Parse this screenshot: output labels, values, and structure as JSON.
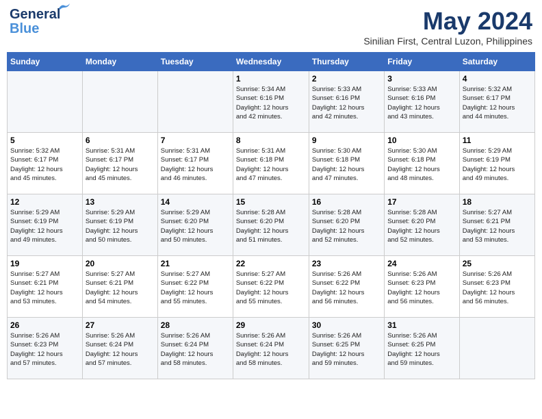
{
  "header": {
    "logo_line1": "General",
    "logo_line2": "Blue",
    "month": "May 2024",
    "location": "Sinilian First, Central Luzon, Philippines"
  },
  "days_of_week": [
    "Sunday",
    "Monday",
    "Tuesday",
    "Wednesday",
    "Thursday",
    "Friday",
    "Saturday"
  ],
  "weeks": [
    {
      "days": [
        {
          "num": "",
          "info": ""
        },
        {
          "num": "",
          "info": ""
        },
        {
          "num": "",
          "info": ""
        },
        {
          "num": "1",
          "info": "Sunrise: 5:34 AM\nSunset: 6:16 PM\nDaylight: 12 hours\nand 42 minutes."
        },
        {
          "num": "2",
          "info": "Sunrise: 5:33 AM\nSunset: 6:16 PM\nDaylight: 12 hours\nand 42 minutes."
        },
        {
          "num": "3",
          "info": "Sunrise: 5:33 AM\nSunset: 6:16 PM\nDaylight: 12 hours\nand 43 minutes."
        },
        {
          "num": "4",
          "info": "Sunrise: 5:32 AM\nSunset: 6:17 PM\nDaylight: 12 hours\nand 44 minutes."
        }
      ]
    },
    {
      "days": [
        {
          "num": "5",
          "info": "Sunrise: 5:32 AM\nSunset: 6:17 PM\nDaylight: 12 hours\nand 45 minutes."
        },
        {
          "num": "6",
          "info": "Sunrise: 5:31 AM\nSunset: 6:17 PM\nDaylight: 12 hours\nand 45 minutes."
        },
        {
          "num": "7",
          "info": "Sunrise: 5:31 AM\nSunset: 6:17 PM\nDaylight: 12 hours\nand 46 minutes."
        },
        {
          "num": "8",
          "info": "Sunrise: 5:31 AM\nSunset: 6:18 PM\nDaylight: 12 hours\nand 47 minutes."
        },
        {
          "num": "9",
          "info": "Sunrise: 5:30 AM\nSunset: 6:18 PM\nDaylight: 12 hours\nand 47 minutes."
        },
        {
          "num": "10",
          "info": "Sunrise: 5:30 AM\nSunset: 6:18 PM\nDaylight: 12 hours\nand 48 minutes."
        },
        {
          "num": "11",
          "info": "Sunrise: 5:29 AM\nSunset: 6:19 PM\nDaylight: 12 hours\nand 49 minutes."
        }
      ]
    },
    {
      "days": [
        {
          "num": "12",
          "info": "Sunrise: 5:29 AM\nSunset: 6:19 PM\nDaylight: 12 hours\nand 49 minutes."
        },
        {
          "num": "13",
          "info": "Sunrise: 5:29 AM\nSunset: 6:19 PM\nDaylight: 12 hours\nand 50 minutes."
        },
        {
          "num": "14",
          "info": "Sunrise: 5:29 AM\nSunset: 6:20 PM\nDaylight: 12 hours\nand 50 minutes."
        },
        {
          "num": "15",
          "info": "Sunrise: 5:28 AM\nSunset: 6:20 PM\nDaylight: 12 hours\nand 51 minutes."
        },
        {
          "num": "16",
          "info": "Sunrise: 5:28 AM\nSunset: 6:20 PM\nDaylight: 12 hours\nand 52 minutes."
        },
        {
          "num": "17",
          "info": "Sunrise: 5:28 AM\nSunset: 6:20 PM\nDaylight: 12 hours\nand 52 minutes."
        },
        {
          "num": "18",
          "info": "Sunrise: 5:27 AM\nSunset: 6:21 PM\nDaylight: 12 hours\nand 53 minutes."
        }
      ]
    },
    {
      "days": [
        {
          "num": "19",
          "info": "Sunrise: 5:27 AM\nSunset: 6:21 PM\nDaylight: 12 hours\nand 53 minutes."
        },
        {
          "num": "20",
          "info": "Sunrise: 5:27 AM\nSunset: 6:21 PM\nDaylight: 12 hours\nand 54 minutes."
        },
        {
          "num": "21",
          "info": "Sunrise: 5:27 AM\nSunset: 6:22 PM\nDaylight: 12 hours\nand 55 minutes."
        },
        {
          "num": "22",
          "info": "Sunrise: 5:27 AM\nSunset: 6:22 PM\nDaylight: 12 hours\nand 55 minutes."
        },
        {
          "num": "23",
          "info": "Sunrise: 5:26 AM\nSunset: 6:22 PM\nDaylight: 12 hours\nand 56 minutes."
        },
        {
          "num": "24",
          "info": "Sunrise: 5:26 AM\nSunset: 6:23 PM\nDaylight: 12 hours\nand 56 minutes."
        },
        {
          "num": "25",
          "info": "Sunrise: 5:26 AM\nSunset: 6:23 PM\nDaylight: 12 hours\nand 56 minutes."
        }
      ]
    },
    {
      "days": [
        {
          "num": "26",
          "info": "Sunrise: 5:26 AM\nSunset: 6:23 PM\nDaylight: 12 hours\nand 57 minutes."
        },
        {
          "num": "27",
          "info": "Sunrise: 5:26 AM\nSunset: 6:24 PM\nDaylight: 12 hours\nand 57 minutes."
        },
        {
          "num": "28",
          "info": "Sunrise: 5:26 AM\nSunset: 6:24 PM\nDaylight: 12 hours\nand 58 minutes."
        },
        {
          "num": "29",
          "info": "Sunrise: 5:26 AM\nSunset: 6:24 PM\nDaylight: 12 hours\nand 58 minutes."
        },
        {
          "num": "30",
          "info": "Sunrise: 5:26 AM\nSunset: 6:25 PM\nDaylight: 12 hours\nand 59 minutes."
        },
        {
          "num": "31",
          "info": "Sunrise: 5:26 AM\nSunset: 6:25 PM\nDaylight: 12 hours\nand 59 minutes."
        },
        {
          "num": "",
          "info": ""
        }
      ]
    }
  ]
}
